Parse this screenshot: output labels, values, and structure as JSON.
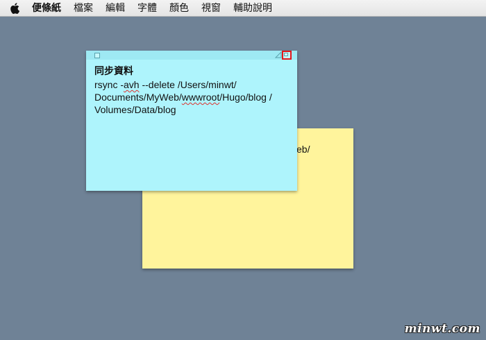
{
  "menubar": {
    "apple_icon": "apple-logo-icon",
    "app_name": "便條紙",
    "items": [
      "檔案",
      "編輯",
      "字體",
      "顏色",
      "視窗",
      "輔助說明"
    ]
  },
  "blue_note": {
    "title": "同步資料",
    "body_parts": {
      "p1": "rsync -",
      "p2_spell": "avh",
      "p3": " --delete /Users/minwt/",
      "p4": "Documents/MyWeb/",
      "p5_spell": "wwwroot",
      "p6": "/Hugo/blog /",
      "p7": "Volumes/Data/blog"
    },
    "color": "#aef4fc",
    "highlighted_control": "collapse-button"
  },
  "yellow_note": {
    "visible_text": "eb/",
    "color": "#fff49c"
  },
  "desktop_color": "#6f8296",
  "watermark": "minwt.com"
}
